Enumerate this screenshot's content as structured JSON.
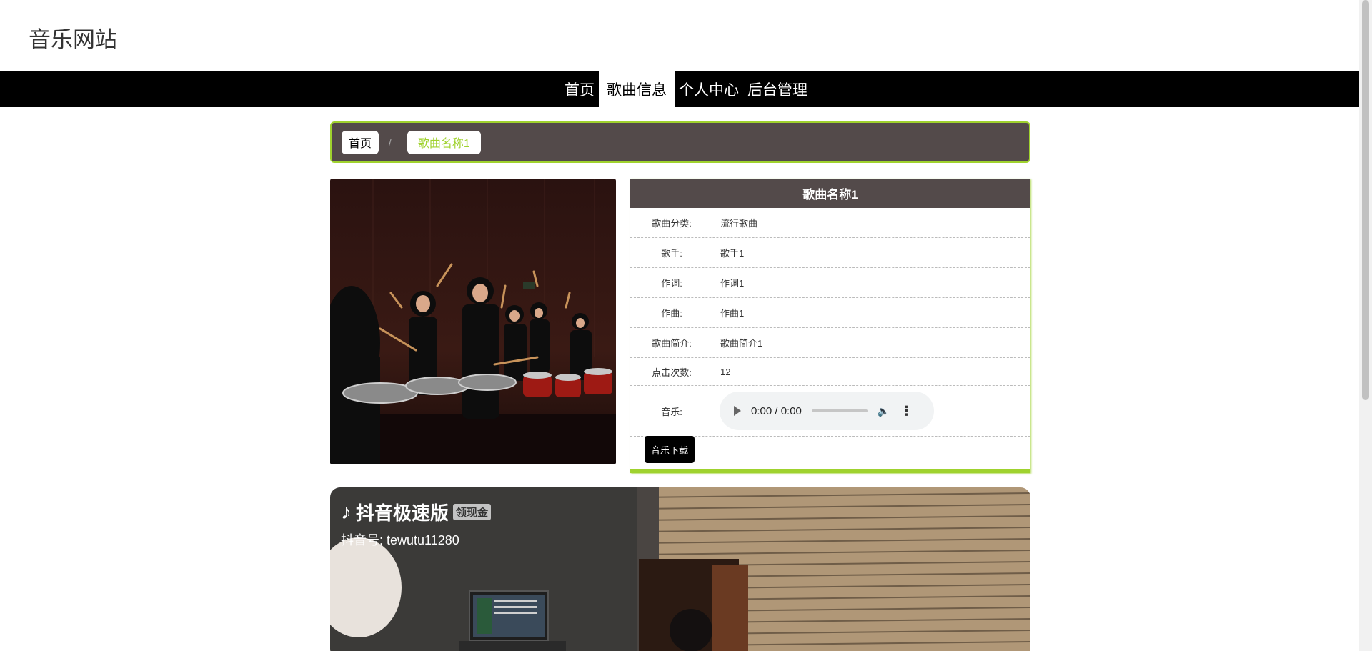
{
  "site": {
    "title": "音乐网站"
  },
  "nav": {
    "items": [
      {
        "label": "首页",
        "active": false
      },
      {
        "label": "歌曲信息",
        "active": true
      },
      {
        "label": "个人中心",
        "active": false
      },
      {
        "label": "后台管理",
        "active": false
      }
    ]
  },
  "breadcrumb": {
    "home": "首页",
    "separator": "/",
    "current": "歌曲名称1"
  },
  "song": {
    "title": "歌曲名称1",
    "fields": [
      {
        "label": "歌曲分类:",
        "value": "流行歌曲"
      },
      {
        "label": "歌手:",
        "value": "歌手1"
      },
      {
        "label": "作词:",
        "value": "作词1"
      },
      {
        "label": "作曲:",
        "value": "作曲1"
      },
      {
        "label": "歌曲简介:",
        "value": "歌曲简介1"
      },
      {
        "label": "点击次数:",
        "value": "12"
      }
    ],
    "audio_label": "音乐:",
    "audio_time": "0:00 / 0:00",
    "download_label": "音乐下载"
  },
  "video": {
    "brand": "抖音极速版",
    "tag": "领现金",
    "account": "抖音号: tewutu11280"
  },
  "colors": {
    "accent": "#9fd22e",
    "panel_dark": "#534a4a",
    "nav_bg": "#000000"
  }
}
